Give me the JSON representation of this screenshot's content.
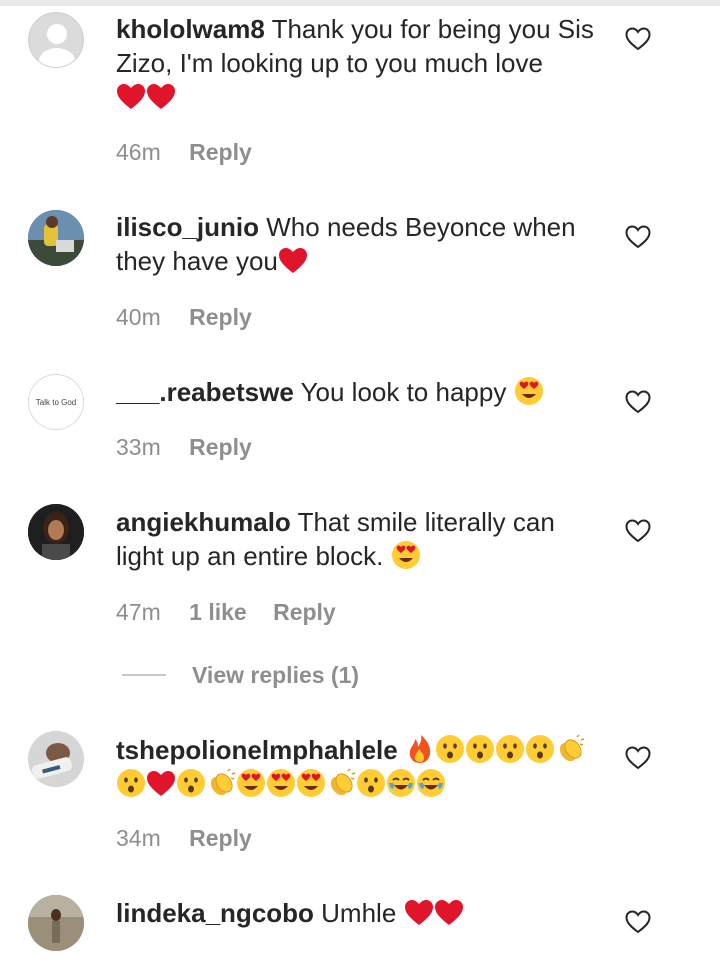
{
  "comments": [
    {
      "username": "khololwam8",
      "text": "Thank you for being you Sis Zizo, I'm looking up to you much love",
      "emojis": [
        "red-heart",
        "red-heart"
      ],
      "time": "46m",
      "likes": "",
      "reply_label": "Reply"
    },
    {
      "username": "ilisco_junio",
      "text": "Who needs Beyonce when they have you",
      "emojis": [
        "red-heart"
      ],
      "time": "40m",
      "likes": "",
      "reply_label": "Reply"
    },
    {
      "username": "___.reabetswe",
      "text": "You look to happy",
      "emojis": [
        "heart-eyes"
      ],
      "avatar_text": "Talk to God",
      "time": "33m",
      "likes": "",
      "reply_label": "Reply"
    },
    {
      "username": "angiekhumalo",
      "text": "That smile literally can light up an entire block.",
      "emojis": [
        "heart-eyes"
      ],
      "time": "47m",
      "likes": "1 like",
      "reply_label": "Reply"
    },
    {
      "username": "tshepolionelmphahlele",
      "text": "",
      "emojis": [
        "fire",
        "hushed",
        "hushed",
        "hushed",
        "hushed",
        "clap",
        "hushed",
        "red-heart",
        "hushed",
        "clap",
        "heart-eyes",
        "heart-eyes",
        "heart-eyes",
        "clap",
        "hushed",
        "joy",
        "joy"
      ],
      "time": "34m",
      "likes": "",
      "reply_label": "Reply"
    },
    {
      "username": "lindeka_ngcobo",
      "text": "Umhle",
      "emojis": [
        "red-heart",
        "red-heart"
      ]
    }
  ],
  "view_replies_label": "View replies (1)",
  "icons": {
    "like": "heart-outline-icon"
  },
  "colors": {
    "meta": "#8e8e8e",
    "text": "#262626",
    "heart": "#e0142a"
  }
}
